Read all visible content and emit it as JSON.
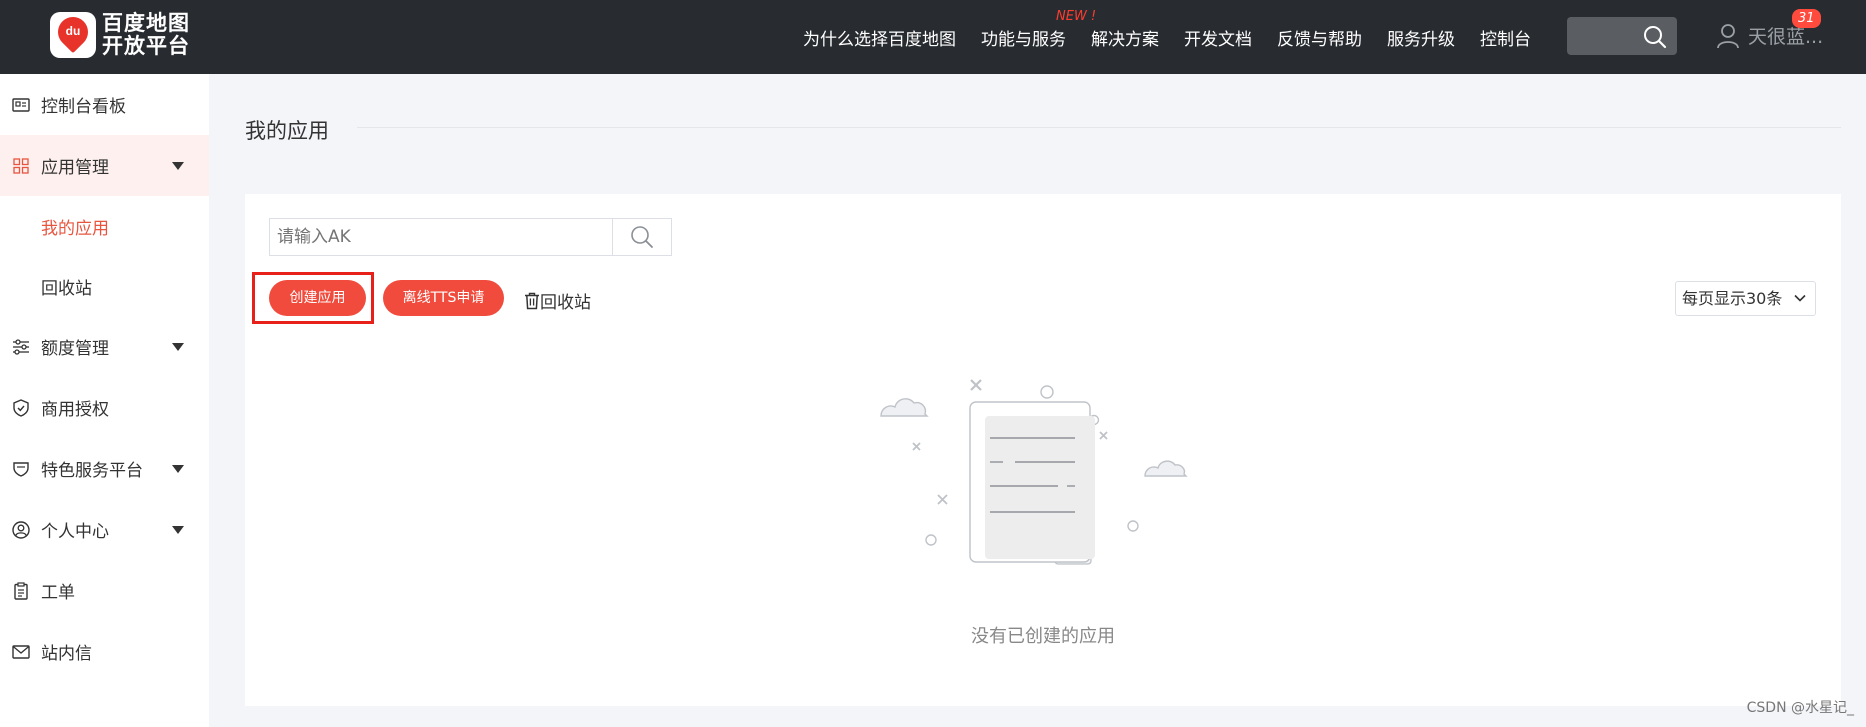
{
  "header": {
    "logo_line1": "百度地图",
    "logo_line2": "开放平台",
    "logo_mark": "du",
    "nav": [
      "为什么选择百度地图",
      "功能与服务",
      "解决方案",
      "开发文档",
      "反馈与帮助",
      "服务升级",
      "控制台"
    ],
    "new_badge": "NEW !",
    "user_name": "天很蓝...",
    "notification_count": "31"
  },
  "sidebar": {
    "items": [
      {
        "label": "控制台看板",
        "icon": "id-card-icon"
      },
      {
        "label": "应用管理",
        "icon": "grid-icon"
      },
      {
        "label": "我的应用"
      },
      {
        "label": "回收站"
      },
      {
        "label": "额度管理",
        "icon": "sliders-icon"
      },
      {
        "label": "商用授权",
        "icon": "shield-check-icon"
      },
      {
        "label": "特色服务平台",
        "icon": "shield-heart-icon"
      },
      {
        "label": "个人中心",
        "icon": "user-circle-icon"
      },
      {
        "label": "工单",
        "icon": "clipboard-icon"
      },
      {
        "label": "站内信",
        "icon": "mail-icon"
      }
    ]
  },
  "main": {
    "title": "我的应用",
    "search_placeholder": "请输入AK",
    "create_button": "创建应用",
    "tts_button": "离线TTS申请",
    "recycle_link": "回收站",
    "per_page": "每页显示30条",
    "empty_text": "没有已创建的应用"
  },
  "watermark": "CSDN @水星记_",
  "colors": {
    "header_bg": "#282c30",
    "accent": "#f04b3c",
    "active_text": "#e8553f",
    "active_bg": "#fdf0ee"
  }
}
